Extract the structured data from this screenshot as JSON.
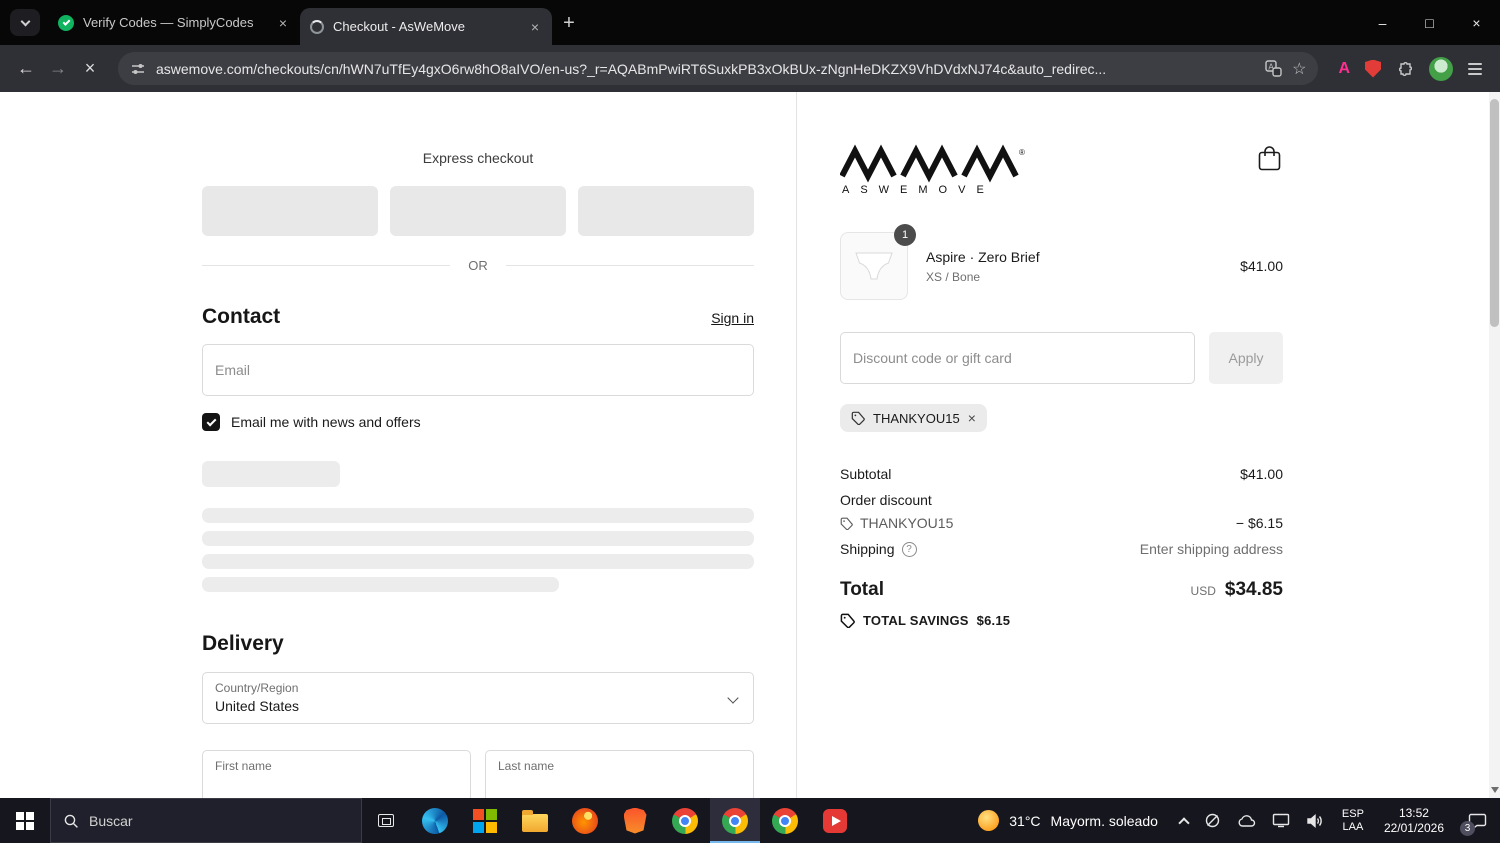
{
  "browser": {
    "tabs": [
      {
        "title": "Verify Codes — SimplyCodes"
      },
      {
        "title": "Checkout - AsWeMove"
      }
    ],
    "url": "aswemove.com/checkouts/cn/hWN7uTfEy4gxO6rw8hO8aIVO/en-us?_r=AQABmPwiRT6SuxkPB3xOkBUx-zNgnHeDKZX9VhDVdxNJ74c&auto_redirec...",
    "ext_a_label": "A"
  },
  "icons": {
    "close": "×",
    "plus": "+",
    "minimize": "–",
    "maximize": "□",
    "back": "←",
    "forward": "→",
    "stop": "×",
    "star": "☆",
    "question": "?",
    "registered": "®"
  },
  "checkout": {
    "express_label": "Express checkout",
    "or_label": "OR",
    "contact_title": "Contact",
    "signin_label": "Sign in",
    "email_placeholder": "Email",
    "news_label": "Email me with news and offers",
    "delivery_title": "Delivery",
    "country_label": "Country/Region",
    "country_value": "United States",
    "first_name_label": "First name",
    "last_name_label": "Last name"
  },
  "summary": {
    "brand_letters": "ASWEMOVE",
    "item_qty": "1",
    "item_title": "Aspire · Zero Brief",
    "item_variant": "XS / Bone",
    "item_price": "$41.00",
    "discount_placeholder": "Discount code or gift card",
    "apply_label": "Apply",
    "chip_code": "THANKYOU15",
    "subtotal_label": "Subtotal",
    "subtotal_value": "$41.00",
    "order_discount_label": "Order discount",
    "discount_code": "THANKYOU15",
    "discount_value": "− $6.15",
    "shipping_label": "Shipping",
    "shipping_value": "Enter shipping address",
    "total_label": "Total",
    "currency": "USD",
    "total_value": "$34.85",
    "savings_label": "TOTAL SAVINGS",
    "savings_value": "$6.15"
  },
  "taskbar": {
    "search_placeholder": "Buscar",
    "weather_temp": "31°C",
    "weather_desc": "Mayorm. soleado",
    "lang_top": "ESP",
    "lang_bottom": "LAA",
    "time": "13:52",
    "date": "22/01/2026",
    "notif_count": "3"
  },
  "colors": {
    "brand_black": "#111111",
    "favicon_green": "#10b35f",
    "ext_a_pink": "#ff2e92",
    "shield_red": "#e23c39",
    "taskbar_bg": "#16161f"
  }
}
